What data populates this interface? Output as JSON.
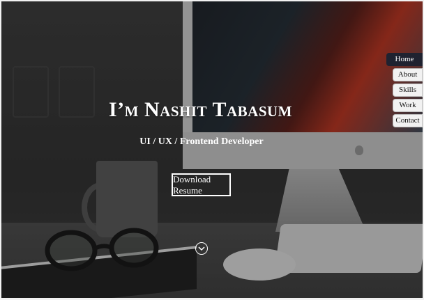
{
  "hero": {
    "title": "I’m Nashit Tabasum",
    "subtitle": "UI / UX / Frontend Developer",
    "resume_label": "Download Resume",
    "scroll_icon": "chevron-down-icon"
  },
  "nav": {
    "items": [
      {
        "label": "Home",
        "active": true
      },
      {
        "label": "About",
        "active": false
      },
      {
        "label": "Skills",
        "active": false
      },
      {
        "label": "Work",
        "active": false
      },
      {
        "label": "Contact",
        "active": false
      }
    ]
  },
  "colors": {
    "active_nav_bg": "#1f2230",
    "nav_bg": "#f2f2f2",
    "text": "#ffffff"
  }
}
